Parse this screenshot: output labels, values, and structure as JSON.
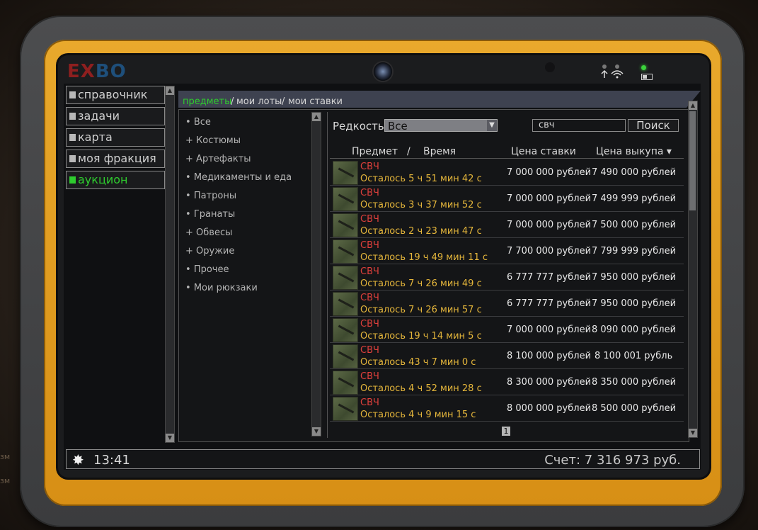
{
  "background": {
    "side_labels": [
      "зм",
      "зм"
    ]
  },
  "header": {
    "logo_part1": "EX",
    "logo_part2": "BO"
  },
  "nav": {
    "items": [
      {
        "label": "справочник",
        "active": false
      },
      {
        "label": "задачи",
        "active": false
      },
      {
        "label": "карта",
        "active": false
      },
      {
        "label": "моя фракция",
        "active": false
      },
      {
        "label": "аукцион",
        "active": true
      }
    ]
  },
  "breadcrumb": {
    "items": [
      "предметы",
      "мои лоты",
      "мои ставки"
    ],
    "separator": "/",
    "active_color": "#2ecc2e",
    "inactive_color": "#d8d8d8"
  },
  "categories": [
    {
      "prefix": "•",
      "label": "Все"
    },
    {
      "prefix": "+",
      "label": "Костюмы"
    },
    {
      "prefix": "+",
      "label": "Артефакты"
    },
    {
      "prefix": "•",
      "label": "Медикаменты и еда"
    },
    {
      "prefix": "•",
      "label": "Патроны"
    },
    {
      "prefix": "•",
      "label": "Гранаты"
    },
    {
      "prefix": "+",
      "label": "Обвесы"
    },
    {
      "prefix": "+",
      "label": "Оружие"
    },
    {
      "prefix": "•",
      "label": "Прочее"
    },
    {
      "prefix": "•",
      "label": "Мои рюкзаки"
    }
  ],
  "filter": {
    "rarity_label": "Редкость",
    "rarity_value": "Все",
    "search_value": "свч",
    "search_button": "Поиск"
  },
  "table": {
    "headers": {
      "item": "Предмет",
      "sep": "/",
      "time": "Время",
      "bid": "Цена ставки",
      "buyout": "Цена выкупа ▾"
    },
    "rows": [
      {
        "name": "СВЧ",
        "time": "Осталось 5 ч 51 мин 42 с",
        "bid": "7 000 000 рублей",
        "buyout": "7 490 000 рублей"
      },
      {
        "name": "СВЧ",
        "time": "Осталось 3 ч 37 мин 52 с",
        "bid": "7 000 000 рублей",
        "buyout": "7 499 999 рублей"
      },
      {
        "name": "СВЧ",
        "time": "Осталось 2 ч 23 мин 47 с",
        "bid": "7 000 000 рублей",
        "buyout": "7 500 000 рублей"
      },
      {
        "name": "СВЧ",
        "time": "Осталось 19 ч 49 мин 11 с",
        "bid": "7 700 000 рублей",
        "buyout": "7 799 999 рублей"
      },
      {
        "name": "СВЧ",
        "time": "Осталось 7 ч 26 мин 49 с",
        "bid": "6 777 777 рублей",
        "buyout": "7 950 000 рублей"
      },
      {
        "name": "СВЧ",
        "time": "Осталось 7 ч 26 мин 57 с",
        "bid": "6 777 777 рублей",
        "buyout": "7 950 000 рублей"
      },
      {
        "name": "СВЧ",
        "time": "Осталось 19 ч 14 мин 5 с",
        "bid": "7 000 000 рублей",
        "buyout": "8 090 000 рублей"
      },
      {
        "name": "СВЧ",
        "time": "Осталось 43 ч 7 мин 0 с",
        "bid": "8 100 000 рублей",
        "buyout": "8 100 001 рубль"
      },
      {
        "name": "СВЧ",
        "time": "Осталось 4 ч 52 мин 28 с",
        "bid": "8 300 000 рублей",
        "buyout": "8 350 000 рублей"
      },
      {
        "name": "СВЧ",
        "time": "Осталось 4 ч 9 мин 15 с",
        "bid": "8 000 000 рублей",
        "buyout": "8 500 000 рублей"
      }
    ],
    "page": "1"
  },
  "footer": {
    "time": "13:41",
    "balance": "Счет: 7 316 973 руб."
  },
  "colors": {
    "item_name": "#e0403c",
    "time_left": "#e5b63b",
    "active_green": "#2ecc2e",
    "frame_yellow": "#e9a92c"
  },
  "icons": [
    "camera-icon",
    "wifi-signal-icon",
    "battery-icon",
    "sun-icon",
    "dropdown-arrow-icon"
  ]
}
